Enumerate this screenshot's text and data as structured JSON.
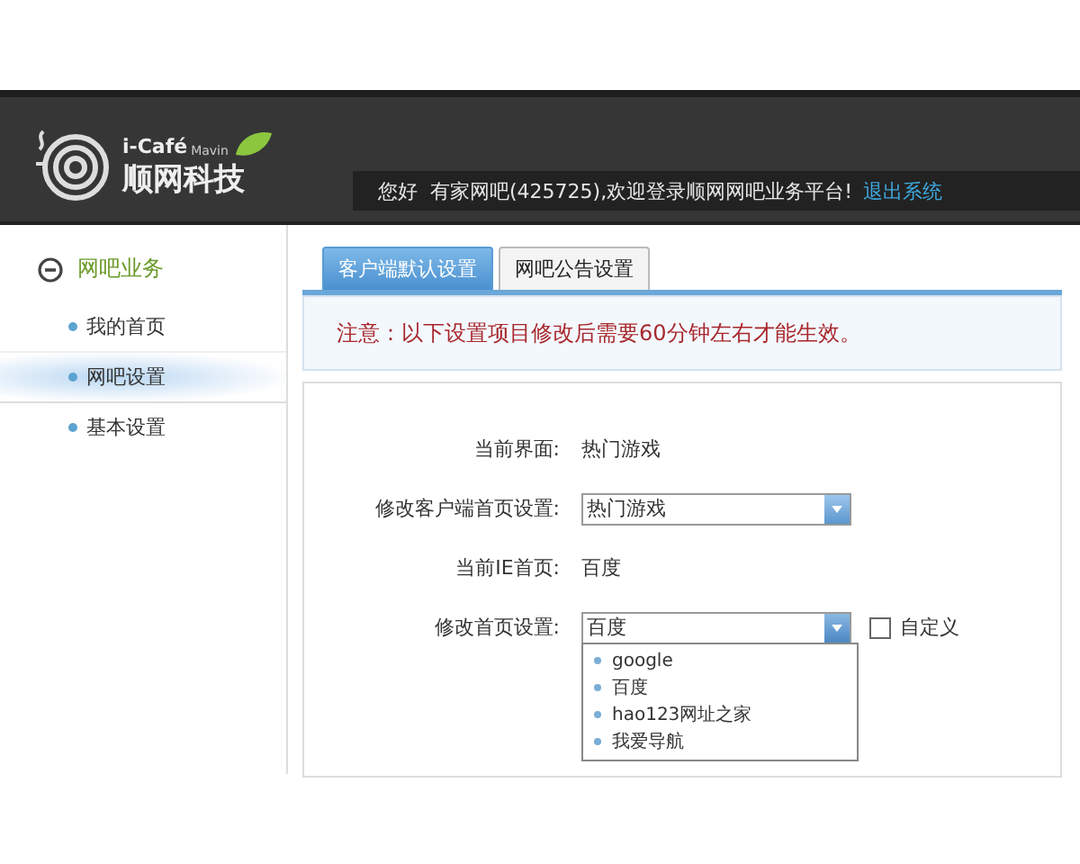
{
  "header": {
    "logo_brand": "i-Café",
    "logo_sub": "Mavin",
    "logo_name": "顺网科技",
    "welcome": "您好  有家网吧(425725),欢迎登录顺网网吧业务平台!",
    "logout_link": "退出系统"
  },
  "sidebar": {
    "section": {
      "label": "网吧业务",
      "expanded": true
    },
    "items": [
      {
        "label": "我的首页",
        "selected": false
      },
      {
        "label": "网吧设置",
        "selected": true
      },
      {
        "label": "基本设置",
        "selected": false
      }
    ]
  },
  "tabs": [
    {
      "label": "客户端默认设置",
      "selected": true
    },
    {
      "label": "网吧公告设置",
      "selected": false
    }
  ],
  "notice": "注意：以下设置项目修改后需要60分钟左右才能生效。",
  "form": [
    {
      "kind": "text",
      "label": "当前界面:",
      "value": "热门游戏"
    },
    {
      "kind": "select",
      "label": "修改客户端首页设置:",
      "value": "热门游戏"
    },
    {
      "kind": "text",
      "label": "当前IE首页:",
      "value": "百度"
    },
    {
      "kind": "select",
      "label": "修改首页设置:",
      "value": "百度",
      "expanded": true,
      "options": [
        "google",
        "百度",
        "hao123网址之家",
        "我爱导航"
      ],
      "checkbox": {
        "label": "自定义",
        "checked": false
      }
    }
  ]
}
